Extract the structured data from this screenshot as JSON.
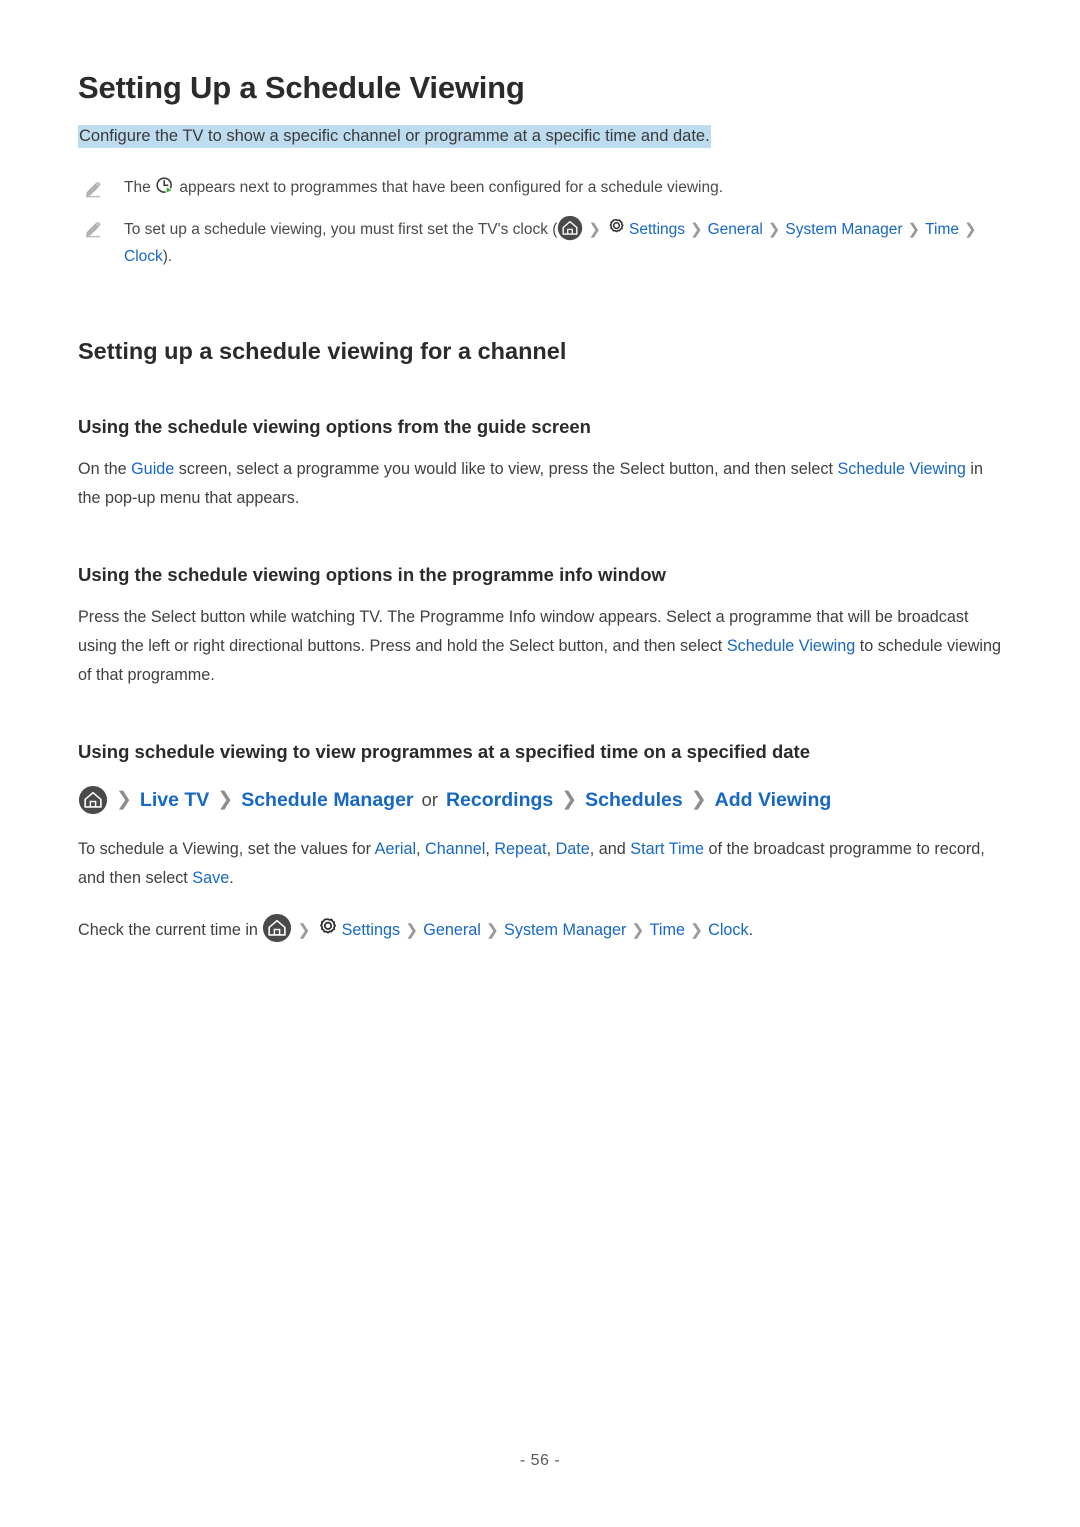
{
  "document": {
    "title": "Setting Up a Schedule Viewing",
    "subtitle": "Configure the TV to show a specific channel or programme at a specific time and date.",
    "highlight_color": "#bedcef",
    "link_color": "#1668c4",
    "page_number": "- 56 -"
  },
  "notes": [
    {
      "icon": "pencil-icon",
      "before_icon": "The ",
      "inline_icon": "schedule-clock-icon",
      "after_icon": " appears next to programmes that have been configured for a schedule viewing."
    },
    {
      "icon": "pencil-icon",
      "lead": "To set up a schedule viewing, you must first set the TV's clock (",
      "path": [
        "Settings",
        "General",
        "System Manager",
        "Time",
        "Clock"
      ],
      "trail": ")."
    }
  ],
  "sections": {
    "channel": {
      "heading": "Setting up a schedule viewing for a channel",
      "guide": {
        "heading": "Using the schedule viewing options from the guide screen",
        "p1_a": "On the ",
        "p1_link1": "Guide",
        "p1_b": " screen, select a programme you would like to view, press the Select button, and then select ",
        "p1_link2": "Schedule Viewing",
        "p1_c": " in the pop-up menu that appears."
      },
      "info_window": {
        "heading": "Using the schedule viewing options in the programme info window",
        "p1_a": "Press the Select button while watching TV. The Programme Info window appears. Select a programme that will be broadcast using the left or right directional buttons. Press and hold the Select button, and then select ",
        "p1_link1": "Schedule Viewing",
        "p1_b": " to schedule viewing of that programme."
      },
      "specified_time": {
        "heading": "Using schedule viewing to view programmes at a specified time on a specified date",
        "breadcrumb": {
          "home_icon": "home-icon",
          "items": [
            {
              "label": "Live TV",
              "type": "link"
            },
            {
              "label": "Schedule Manager",
              "type": "link"
            },
            {
              "label": "or",
              "type": "plain"
            },
            {
              "label": "Recordings",
              "type": "link"
            },
            {
              "label": "Schedules",
              "type": "link"
            },
            {
              "label": "Add Viewing",
              "type": "link"
            }
          ]
        },
        "p1_a": "To schedule a Viewing, set the values for ",
        "p1_values": [
          "Aerial",
          "Channel",
          "Repeat",
          "Date",
          "Start Time"
        ],
        "p1_b": " of the broadcast programme to record, and then select ",
        "p1_save": "Save",
        "p1_c": ".",
        "p2_a": "Check the current time in ",
        "p2_path": [
          "Settings",
          "General",
          "System Manager",
          "Time",
          "Clock"
        ],
        "p2_b": "."
      }
    }
  }
}
